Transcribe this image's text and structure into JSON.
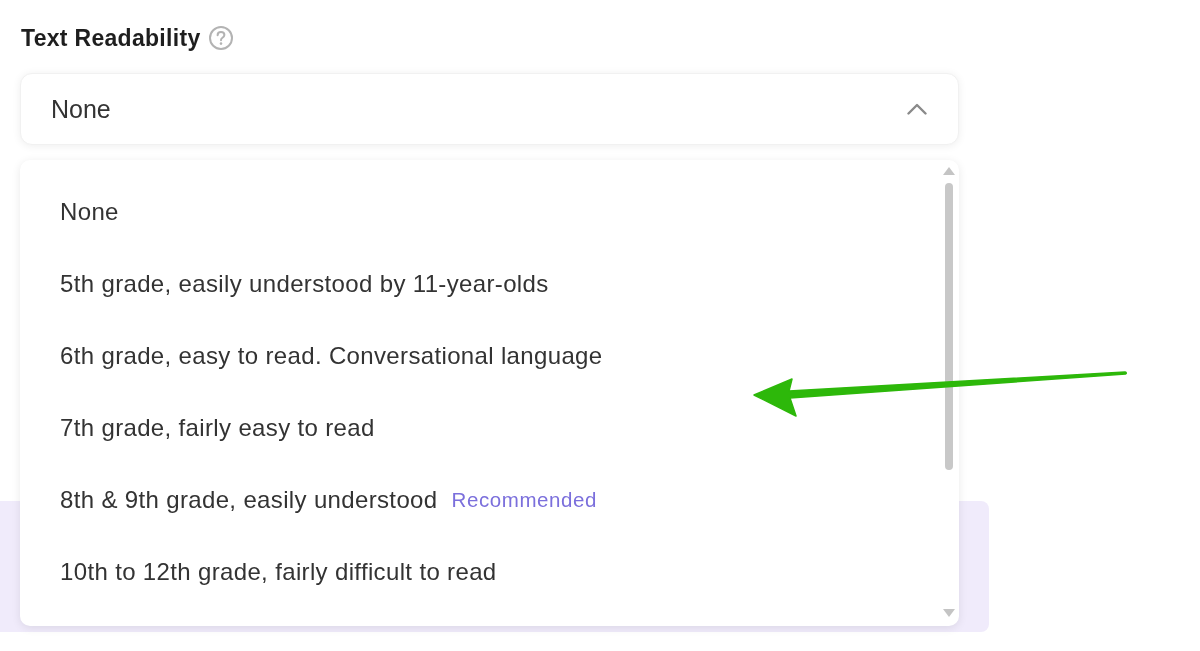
{
  "field": {
    "label": "Text Readability",
    "value": "None",
    "expanded": true
  },
  "dropdown": {
    "options": [
      {
        "label": "None",
        "selected": false
      },
      {
        "label": "5th grade, easily understood by 11-year-olds",
        "selected": false
      },
      {
        "label": "6th grade, easy to read. Conversational language",
        "selected": false
      },
      {
        "label": "7th grade, fairly easy to read",
        "selected": false
      },
      {
        "label": "8th & 9th grade, easily understood",
        "badge": "Recommended",
        "selected": false
      },
      {
        "label": "10th to 12th grade, fairly difficult to read",
        "selected": false
      }
    ]
  }
}
